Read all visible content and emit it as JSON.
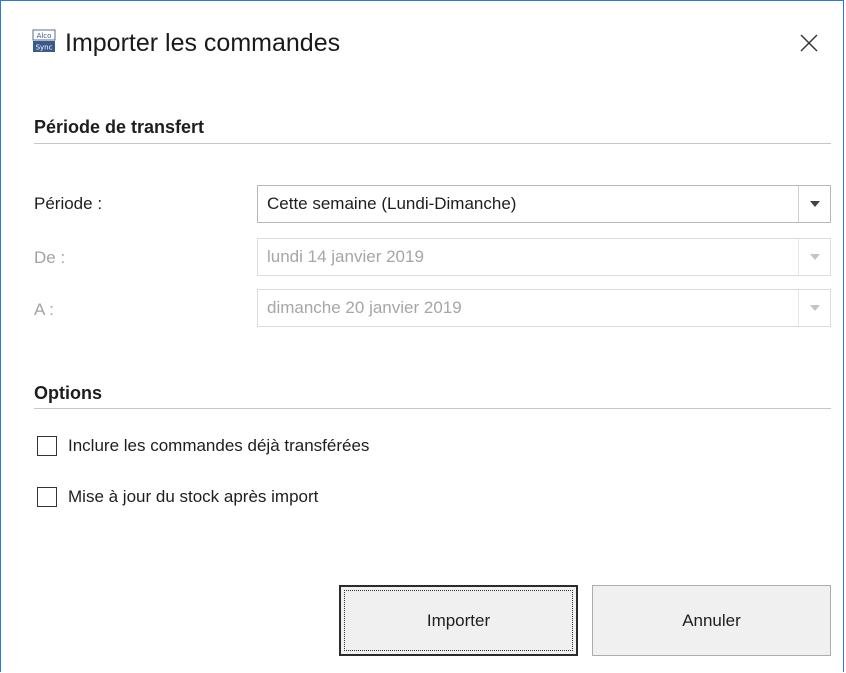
{
  "window": {
    "title": "Importer les commandes",
    "icon": "alcoo-sync-icon",
    "icon_text_top": "Alco",
    "icon_text_bottom": "Sync"
  },
  "sections": {
    "period": {
      "title": "Période de transfert"
    },
    "options": {
      "title": "Options"
    }
  },
  "fields": {
    "periode": {
      "label": "Période :",
      "value": "Cette semaine (Lundi-Dimanche)",
      "enabled": true
    },
    "de": {
      "label": "De :",
      "value": "lundi 14 janvier 2019",
      "enabled": false
    },
    "a": {
      "label": "A :",
      "value": "dimanche 20 janvier 2019",
      "enabled": false
    }
  },
  "options": {
    "include_transferred": {
      "label": "Inclure les commandes déjà transférées",
      "checked": false
    },
    "update_stock": {
      "label": "Mise à jour du stock après import",
      "checked": false
    }
  },
  "buttons": {
    "import": "Importer",
    "cancel": "Annuler"
  },
  "colors": {
    "window_border": "#2b79d4",
    "disabled_text": "#a3a3a3",
    "button_face": "#f0f0f0"
  }
}
